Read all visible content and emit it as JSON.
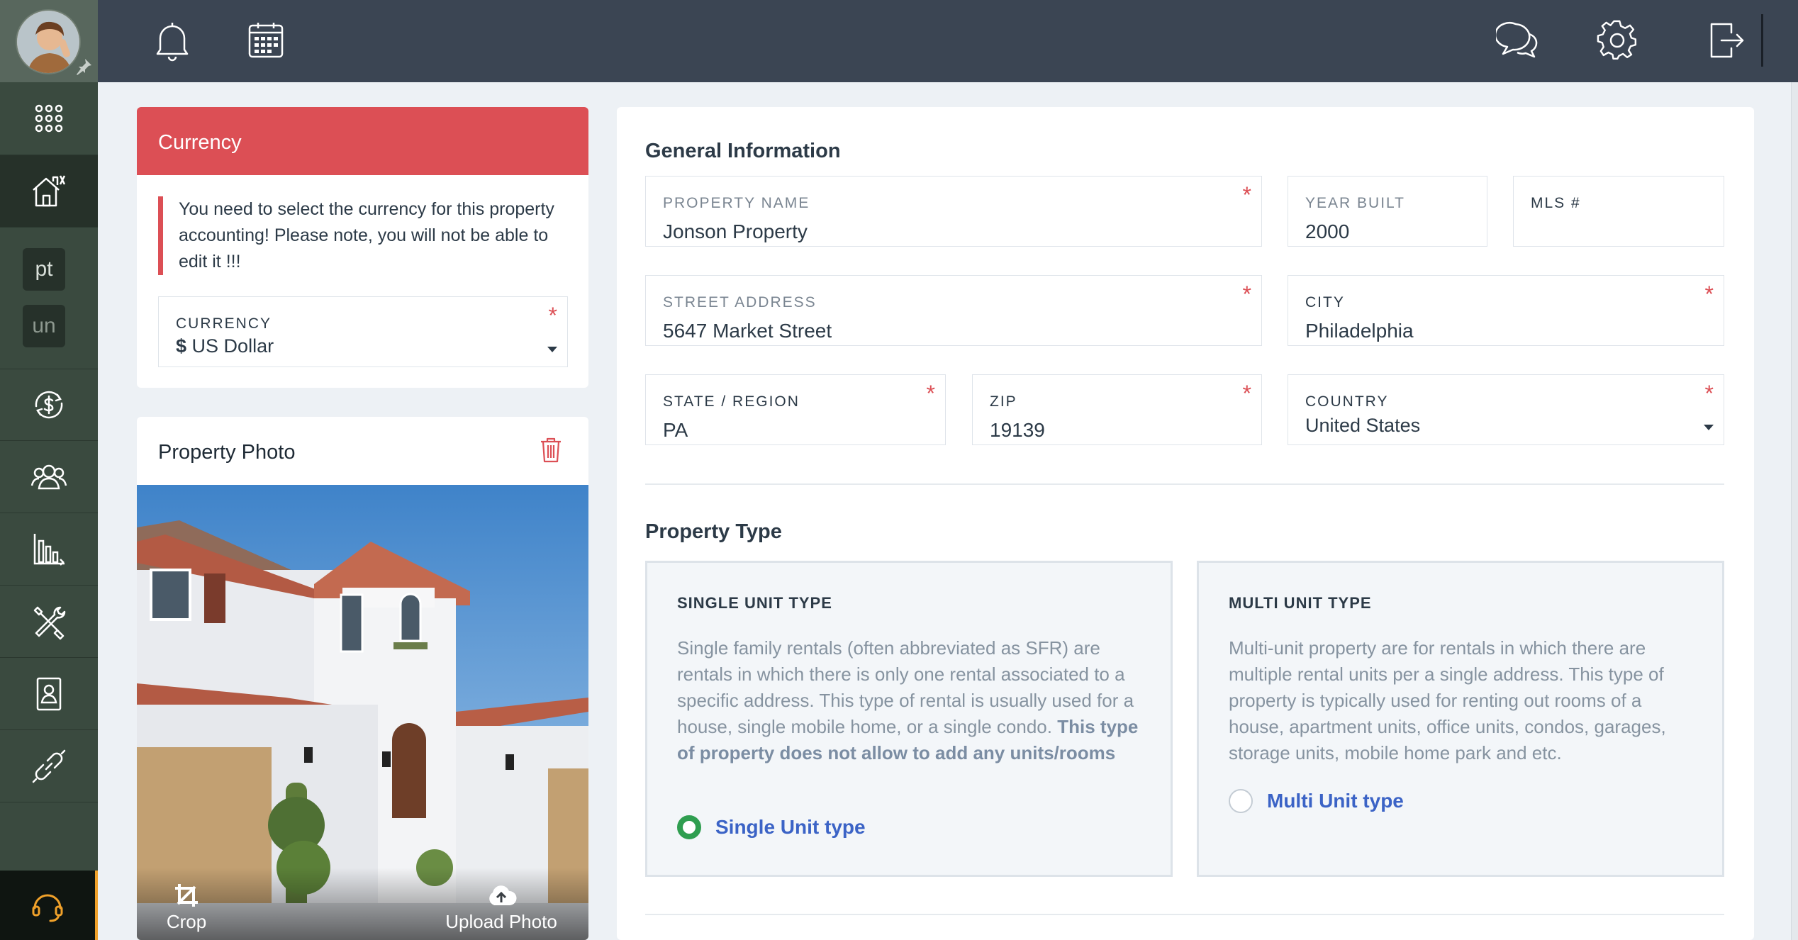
{
  "sidebar": {
    "letters": [
      "pt",
      "un"
    ],
    "items": [
      {
        "icon": "apps-grid-icon",
        "active": false
      },
      {
        "icon": "properties-icon",
        "active": true
      },
      {
        "icon": "accounting-icon",
        "active": false
      },
      {
        "icon": "contacts-icon",
        "active": false
      },
      {
        "icon": "reports-icon",
        "active": false
      },
      {
        "icon": "maintenance-tools-icon",
        "active": false
      },
      {
        "icon": "documents-icon",
        "active": false
      },
      {
        "icon": "integrations-link-icon",
        "active": false
      }
    ],
    "support_icon": "headset-icon",
    "accent_color": "#f0a12a"
  },
  "topbar": {
    "left_icons": [
      "bell-icon",
      "calendar-icon"
    ],
    "right_icons": [
      "chat-icon",
      "gear-icon",
      "logout-icon"
    ]
  },
  "currency": {
    "title": "Currency",
    "alert": "You need to select the currency for this property accounting! Please note, you will not be able to edit it !!!",
    "field_label": "CURRENCY",
    "symbol": "$",
    "value": "US Dollar"
  },
  "photo": {
    "title": "Property Photo",
    "crop_label": "Crop",
    "upload_label": "Upload Photo"
  },
  "general": {
    "title": "General Information",
    "property_name": {
      "label": "PROPERTY NAME",
      "value": "Jonson Property"
    },
    "year_built": {
      "label": "YEAR BUILT",
      "value": "2000"
    },
    "mls": {
      "label": "MLS #",
      "value": ""
    },
    "street": {
      "label": "STREET ADDRESS",
      "value": "5647 Market Street"
    },
    "city": {
      "label": "CITY",
      "value": "Philadelphia"
    },
    "state": {
      "label": "STATE / REGION",
      "value": "PA"
    },
    "zip": {
      "label": "ZIP",
      "value": "19139"
    },
    "country": {
      "label": "COUNTRY",
      "value": "United States"
    }
  },
  "property_type": {
    "title": "Property Type",
    "single": {
      "heading": "SINGLE UNIT TYPE",
      "description": "Single family rentals (often abbreviated as SFR) are rentals in which there is only one rental associated to a specific address. This type of rental is usually used for a house, single mobile home, or a single condo.",
      "note": "This type of property does not allow to add any units/rooms",
      "option": "Single Unit type",
      "selected": true
    },
    "multi": {
      "heading": "MULTI UNIT TYPE",
      "description": "Multi-unit property are for rentals in which there are multiple rental units per a single address. This type of property is typically used for renting out rooms of a house, apartment units, office units, condos, garages, storage units, mobile home park and etc.",
      "option": "Multi Unit type",
      "selected": false
    }
  },
  "colors": {
    "danger": "#dc4f55",
    "radio_selected": "#2f9e50",
    "link_blue": "#3b63c6"
  }
}
